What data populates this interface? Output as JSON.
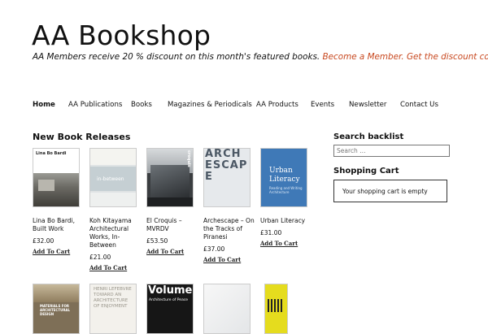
{
  "site": {
    "title": "AA Bookshop",
    "tagline": "AA Members receive 20 % discount on this month's featured books.",
    "become_member": "Become a Member.",
    "discount_coupon": "Get the discount coupon",
    "link_color": "#c8481f"
  },
  "nav": {
    "items": [
      "Home",
      "AA Publications",
      "Books",
      "Magazines & Periodicals",
      "AA Products",
      "Events",
      "Newsletter",
      "Contact Us"
    ],
    "active": "Home"
  },
  "main": {
    "section_title": "New Book Releases",
    "add_to_cart_label": "Add To Cart",
    "books": [
      {
        "title": "Lina Bo Bardi, Built Work",
        "price": "£32.00"
      },
      {
        "title": "Koh Kitayama Architectural Works, In-Between",
        "price": "£21.00"
      },
      {
        "title": "El Croquis – MVRDV",
        "price": "£53.50"
      },
      {
        "title": "Archescape – On the Tracks of Piranesi",
        "price": "£37.00"
      },
      {
        "title": "Urban Literacy",
        "price": "£31.00"
      }
    ],
    "cover_text": {
      "lina": "Lina Bo Bardi",
      "koh": "in-between",
      "croquis": "croquis",
      "archescape": "ARCHESCAPE",
      "urban_title": "Urban Literacy",
      "urban_subtitle": "Reading and Writing Architecture",
      "materials": "MATERIALS FOR ARCHITECTURAL DESIGN",
      "henri": "HENRI LEFEBVRE TOWARD AN ARCHITECTURE OF ENJOYMENT",
      "volume": "Volume",
      "volume_sub": "Architecture of Peace"
    }
  },
  "sidebar": {
    "search_title": "Search backlist",
    "search_placeholder": "Search …",
    "cart_title": "Shopping Cart",
    "cart_empty": "Your shopping cart is empty"
  }
}
